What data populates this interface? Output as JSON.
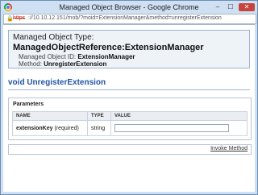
{
  "window": {
    "title": "Managed Object Browser - Google Chrome",
    "controls": {
      "minimize": "–",
      "maximize": "☐",
      "close": "✕"
    }
  },
  "address_bar": {
    "scheme": "https",
    "rest": "://10.10.12.151/mob/?moid=ExtensionManager&method=unregisterExtension"
  },
  "header": {
    "type_label": "Managed Object Type:",
    "type_value": "ManagedObjectReference:ExtensionManager",
    "id_label": "Managed Object ID:",
    "id_value": "ExtensionManager",
    "method_label": "Method:",
    "method_value": "UnregisterExtension"
  },
  "method_signature": "void UnregisterExtension",
  "parameters": {
    "title": "Parameters",
    "columns": [
      "NAME",
      "TYPE",
      "VALUE"
    ],
    "rows": [
      {
        "name": "extensionKey",
        "qualifier": "(required)",
        "type": "string",
        "value": ""
      }
    ]
  },
  "invoke": {
    "label": "Invoke Method"
  },
  "colors": {
    "accent": "#2255a4",
    "frame": "#cfe0f3",
    "warning": "#c0392b"
  }
}
